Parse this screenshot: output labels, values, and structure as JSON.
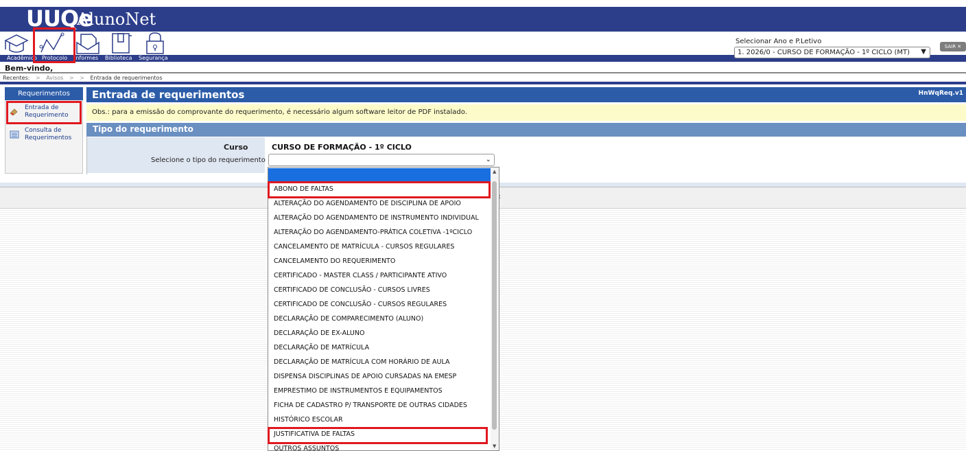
{
  "header": {
    "logo": "UUQe",
    "app_name": "AlunoNet",
    "nav": [
      {
        "label": "Acadêmico",
        "icon": "graduation-cap-icon"
      },
      {
        "label": "Protocolo",
        "icon": "line-chart-icon"
      },
      {
        "label": "Informes",
        "icon": "envelope-icon"
      },
      {
        "label": "Biblioteca",
        "icon": "book-icon"
      },
      {
        "label": "Segurança",
        "icon": "lock-icon"
      }
    ],
    "ano_label": "Selecionar Ano e P.Letivo",
    "ano_value": "1. 2026/0 - CURSO DE FORMAÇÃO - 1º CICLO (MT)",
    "sair_label": "SAIR ✕"
  },
  "welcome": "Bem-vindo,",
  "breadcrumb": {
    "recentes": "Recentes:",
    "items": [
      "Avisos",
      "Entrada de requerimentos"
    ]
  },
  "sidebar": {
    "title": "Requerimentos",
    "items": [
      {
        "label": "Entrada de Requerimento",
        "icon": "document-edit-icon"
      },
      {
        "label": "Consulta de Requerimentos",
        "icon": "list-document-icon"
      }
    ]
  },
  "main": {
    "title": "Entrada de requerimentos",
    "code": "HnWqReq.v1",
    "obs": "Obs.: para a emissão do comprovante do requerimento, é necessário algum software leitor de PDF instalado.",
    "section_title": "Tipo do requerimento",
    "curso_label": "Curso",
    "curso_value": "CURSO DE FORMAÇÃO - 1º CICLO",
    "tipo_label": "Selecione o tipo do requerimento",
    "tipo_value": ""
  },
  "dropdown": {
    "options": [
      "ABONO DE FALTAS",
      "ALTERAÇÃO DO AGENDAMENTO DE DISCIPLINA DE APOIO",
      "ALTERAÇÃO DO AGENDAMENTO DE INSTRUMENTO INDIVIDUAL",
      "ALTERAÇÃO DO AGENDAMENTO-PRÁTICA COLETIVA -1ºCICLO",
      "CANCELAMENTO DE MATRÍCULA - CURSOS REGULARES",
      "CANCELAMENTO DO REQUERIMENTO",
      "CERTIFICADO - MASTER CLASS / PARTICIPANTE ATIVO",
      "CERTIFICADO DE CONCLUSÃO - CURSOS LIVRES",
      "CERTIFICADO DE CONCLUSÃO - CURSOS REGULARES",
      "DECLARAÇÃO DE COMPARECIMENTO (ALUNO)",
      "DECLARAÇÃO DE EX-ALUNO",
      "DECLARAÇÃO DE MATRÍCULA",
      "DECLARAÇÃO DE MATRÍCULA COM HORÁRIO DE AULA",
      "DISPENSA DISCIPLINAS DE APOIO CURSADAS NA EMESP",
      "EMPRESTIMO DE INSTRUMENTOS E EQUIPAMENTOS",
      "FICHA DE CADASTRO P/ TRANSPORTE DE OUTRAS CIDADES",
      "HISTÓRICO ESCOLAR",
      "JUSTIFICATIVA DE FALTAS",
      "OUTROS ASSUNTOS"
    ]
  },
  "colors": {
    "brand_blue": "#2c3d8a",
    "header_blue": "#2c5ca8",
    "section_blue": "#6a8fc1",
    "highlight_red": "#e0181f",
    "selected_blue": "#1a6fe0",
    "notice_yellow": "#fdfbc9"
  },
  "misc": {
    "colon": ":"
  }
}
